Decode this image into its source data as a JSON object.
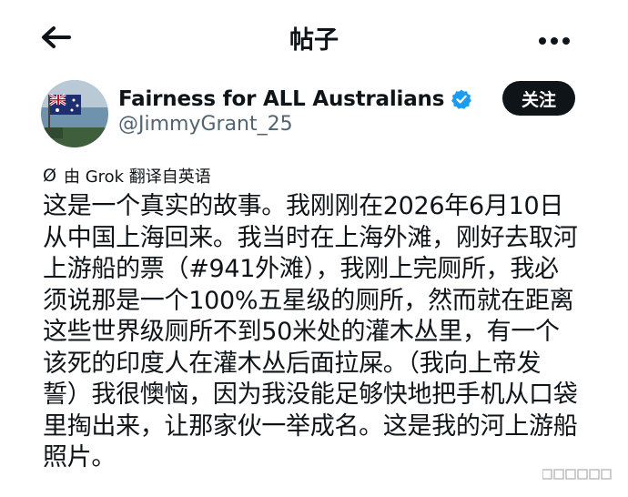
{
  "header": {
    "title": "帖子"
  },
  "author": {
    "name": "Fairness for ALL Australians",
    "handle": "@JimmyGrant_25",
    "verified": true
  },
  "follow_label": "关注",
  "translation_note": "由 Grok 翻译自英语",
  "post": {
    "lines": [
      "这是一个真实的故事。我刚刚在2026年6月10日",
      "从中国上海回来。我当时在上海外滩，刚好去取河",
      "上游船的票（#941外滩），我刚上完厕所，我必",
      "须说那是一个100%五星级的厕所，然而就在距离",
      "这些世界级厕所不到50米处的灌木丛里，有一个",
      "该死的印度人在灌木丛后面拉屎。（我向上帝发",
      "誓）我很懊恼，因为我没能足够快地把手机从口袋",
      "里掏出来，让那家伙一举成名。这是我的河上游船",
      "照片。"
    ]
  },
  "colors": {
    "text": "#0f1419",
    "secondary": "#536471",
    "verified": "#1d9bf0",
    "button_bg": "#0f1419",
    "button_text": "#ffffff"
  },
  "icons": {
    "back": "arrow-left-icon",
    "more": "more-horizontal-icon",
    "verified": "verified-badge-icon",
    "translate": "translate-icon"
  }
}
